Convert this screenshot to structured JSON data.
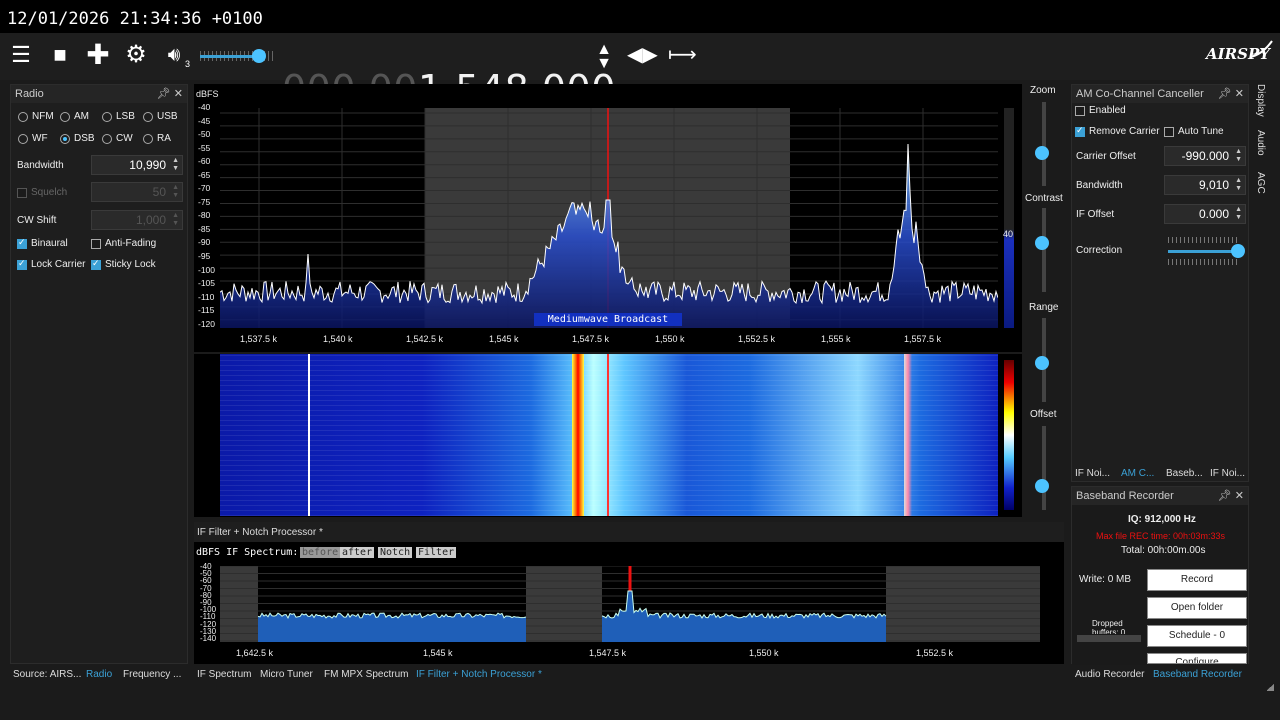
{
  "clock": "12/01/2026 21:34:36 +0100",
  "toolbar": {
    "frequency_dim": "000.00",
    "frequency_bright": "1.548.000",
    "volume_sub": "3",
    "brand": "AIRSPY"
  },
  "radio_panel": {
    "title": "Radio",
    "modes": [
      {
        "label": "NFM",
        "selected": false
      },
      {
        "label": "AM",
        "selected": false
      },
      {
        "label": "LSB",
        "selected": false
      },
      {
        "label": "USB",
        "selected": false
      },
      {
        "label": "WF",
        "selected": false
      },
      {
        "label": "DSB",
        "selected": true
      },
      {
        "label": "CW",
        "selected": false
      },
      {
        "label": "RA",
        "selected": false
      }
    ],
    "bandwidth_label": "Bandwidth",
    "bandwidth_value": "10,990",
    "squelch_label": "Squelch",
    "squelch_value": "50",
    "cw_shift_label": "CW Shift",
    "cw_shift_value": "1,000",
    "binaural": "Binaural",
    "anti_fading": "Anti-Fading",
    "lock_carrier": "Lock Carrier",
    "sticky_lock": "Sticky Lock"
  },
  "left_tabs": [
    "Source: AIRS...",
    "Radio",
    "Frequency ..."
  ],
  "spectrum": {
    "unit": "dBFS",
    "y_ticks": [
      "-40",
      "-45",
      "-50",
      "-55",
      "-60",
      "-65",
      "-70",
      "-75",
      "-80",
      "-85",
      "-90",
      "-95",
      "-100",
      "-105",
      "-110",
      "-115",
      "-120"
    ],
    "x_ticks": [
      "1,537.5 k",
      "1,540 k",
      "1,542.5 k",
      "1,545 k",
      "1,547.5 k",
      "1,550 k",
      "1,552.5 k",
      "1,555 k",
      "1,557.5 k"
    ],
    "band_label": "Mediumwave Broadcast",
    "meter_value": "40"
  },
  "right_sliders": {
    "zoom": "Zoom",
    "contrast": "Contrast",
    "range": "Range",
    "offset": "Offset"
  },
  "cochannel": {
    "title": "AM Co-Channel Canceller",
    "enabled": "Enabled",
    "remove_carrier": "Remove Carrier",
    "auto_tune": "Auto Tune",
    "carrier_offset_label": "Carrier Offset",
    "carrier_offset_value": "-990.000",
    "bandwidth_label": "Bandwidth",
    "bandwidth_value": "9,010",
    "if_offset_label": "IF Offset",
    "if_offset_value": "0.000",
    "correction_label": "Correction",
    "side_tabs": [
      "Display",
      "Audio",
      "AGC"
    ],
    "bottom_tabs": [
      "IF Noi...",
      "AM C...",
      "Baseb...",
      "IF Noi..."
    ]
  },
  "baseband": {
    "title": "Baseband Recorder",
    "iq": "IQ: 912,000 Hz",
    "max_rec": "Max file REC time: 00h:03m:33s",
    "total": "Total: 00h:00m.00s",
    "write": "Write: 0 MB",
    "dropped": "Dropped",
    "dropped2": "buffers: 0",
    "record": "Record",
    "open_folder": "Open folder",
    "schedule": "Schedule - 0",
    "configure": "Configure",
    "bottom_tabs": [
      "Audio Recorder",
      "Baseband Recorder"
    ]
  },
  "if_filter": {
    "title": "IF Filter + Notch Processor *",
    "header_label": "dBFS IF Spectrum:",
    "buttons": [
      "before",
      "after",
      "Notch",
      "Filter"
    ],
    "y_ticks": [
      "-40",
      "-50",
      "-60",
      "-70",
      "-80",
      "-90",
      "-100",
      "-110",
      "-120",
      "-130",
      "-140"
    ],
    "x_ticks": [
      "1,642.5 k",
      "1,545 k",
      "1,547.5 k",
      "1,550 k",
      "1,552.5 k"
    ]
  },
  "bottom_tabs": [
    "IF Spectrum",
    "Micro Tuner",
    "FM MPX Spectrum",
    "IF Filter + Notch Processor *"
  ]
}
